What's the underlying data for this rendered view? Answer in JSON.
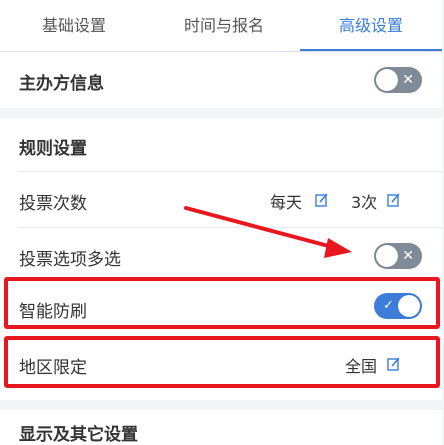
{
  "tabs": [
    {
      "label": "基础设置"
    },
    {
      "label": "时间与报名"
    },
    {
      "label": "高级设置"
    }
  ],
  "organizer": {
    "label": "主办方信息",
    "toggle_on": false
  },
  "rules": {
    "title": "规则设置",
    "vote_count": {
      "label": "投票次数",
      "period": "每天",
      "times": "3次"
    },
    "multi_select": {
      "label": "投票选项多选",
      "toggle_on": false
    },
    "anti_spam": {
      "label": "智能防刷",
      "toggle_on": true
    },
    "region": {
      "label": "地区限定",
      "value": "全国"
    }
  },
  "display": {
    "title": "显示及其它设置"
  },
  "colors": {
    "accent": "#3b7dd8",
    "toggle_off": "#7f8b96",
    "highlight": "#e8171f"
  },
  "icons": {
    "edit": "edit-icon",
    "close": "close-icon",
    "check": "check-icon"
  }
}
